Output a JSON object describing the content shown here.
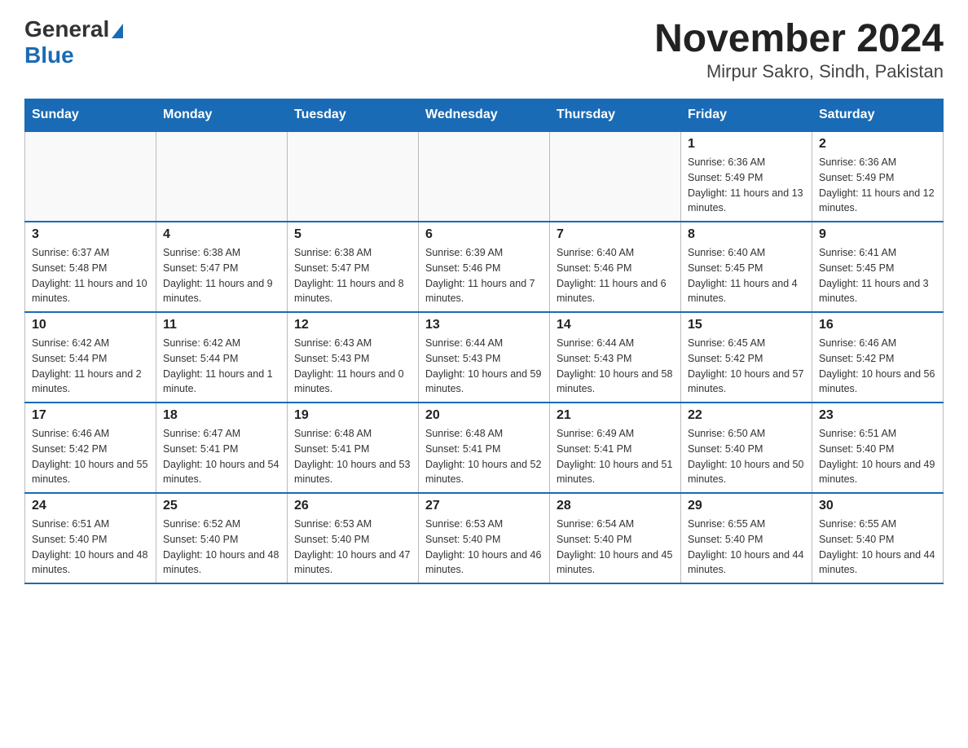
{
  "header": {
    "logo_general": "General",
    "logo_blue": "Blue",
    "title": "November 2024",
    "subtitle": "Mirpur Sakro, Sindh, Pakistan"
  },
  "days_of_week": [
    "Sunday",
    "Monday",
    "Tuesday",
    "Wednesday",
    "Thursday",
    "Friday",
    "Saturday"
  ],
  "weeks": [
    [
      {
        "day": "",
        "info": ""
      },
      {
        "day": "",
        "info": ""
      },
      {
        "day": "",
        "info": ""
      },
      {
        "day": "",
        "info": ""
      },
      {
        "day": "",
        "info": ""
      },
      {
        "day": "1",
        "info": "Sunrise: 6:36 AM\nSunset: 5:49 PM\nDaylight: 11 hours and 13 minutes."
      },
      {
        "day": "2",
        "info": "Sunrise: 6:36 AM\nSunset: 5:49 PM\nDaylight: 11 hours and 12 minutes."
      }
    ],
    [
      {
        "day": "3",
        "info": "Sunrise: 6:37 AM\nSunset: 5:48 PM\nDaylight: 11 hours and 10 minutes."
      },
      {
        "day": "4",
        "info": "Sunrise: 6:38 AM\nSunset: 5:47 PM\nDaylight: 11 hours and 9 minutes."
      },
      {
        "day": "5",
        "info": "Sunrise: 6:38 AM\nSunset: 5:47 PM\nDaylight: 11 hours and 8 minutes."
      },
      {
        "day": "6",
        "info": "Sunrise: 6:39 AM\nSunset: 5:46 PM\nDaylight: 11 hours and 7 minutes."
      },
      {
        "day": "7",
        "info": "Sunrise: 6:40 AM\nSunset: 5:46 PM\nDaylight: 11 hours and 6 minutes."
      },
      {
        "day": "8",
        "info": "Sunrise: 6:40 AM\nSunset: 5:45 PM\nDaylight: 11 hours and 4 minutes."
      },
      {
        "day": "9",
        "info": "Sunrise: 6:41 AM\nSunset: 5:45 PM\nDaylight: 11 hours and 3 minutes."
      }
    ],
    [
      {
        "day": "10",
        "info": "Sunrise: 6:42 AM\nSunset: 5:44 PM\nDaylight: 11 hours and 2 minutes."
      },
      {
        "day": "11",
        "info": "Sunrise: 6:42 AM\nSunset: 5:44 PM\nDaylight: 11 hours and 1 minute."
      },
      {
        "day": "12",
        "info": "Sunrise: 6:43 AM\nSunset: 5:43 PM\nDaylight: 11 hours and 0 minutes."
      },
      {
        "day": "13",
        "info": "Sunrise: 6:44 AM\nSunset: 5:43 PM\nDaylight: 10 hours and 59 minutes."
      },
      {
        "day": "14",
        "info": "Sunrise: 6:44 AM\nSunset: 5:43 PM\nDaylight: 10 hours and 58 minutes."
      },
      {
        "day": "15",
        "info": "Sunrise: 6:45 AM\nSunset: 5:42 PM\nDaylight: 10 hours and 57 minutes."
      },
      {
        "day": "16",
        "info": "Sunrise: 6:46 AM\nSunset: 5:42 PM\nDaylight: 10 hours and 56 minutes."
      }
    ],
    [
      {
        "day": "17",
        "info": "Sunrise: 6:46 AM\nSunset: 5:42 PM\nDaylight: 10 hours and 55 minutes."
      },
      {
        "day": "18",
        "info": "Sunrise: 6:47 AM\nSunset: 5:41 PM\nDaylight: 10 hours and 54 minutes."
      },
      {
        "day": "19",
        "info": "Sunrise: 6:48 AM\nSunset: 5:41 PM\nDaylight: 10 hours and 53 minutes."
      },
      {
        "day": "20",
        "info": "Sunrise: 6:48 AM\nSunset: 5:41 PM\nDaylight: 10 hours and 52 minutes."
      },
      {
        "day": "21",
        "info": "Sunrise: 6:49 AM\nSunset: 5:41 PM\nDaylight: 10 hours and 51 minutes."
      },
      {
        "day": "22",
        "info": "Sunrise: 6:50 AM\nSunset: 5:40 PM\nDaylight: 10 hours and 50 minutes."
      },
      {
        "day": "23",
        "info": "Sunrise: 6:51 AM\nSunset: 5:40 PM\nDaylight: 10 hours and 49 minutes."
      }
    ],
    [
      {
        "day": "24",
        "info": "Sunrise: 6:51 AM\nSunset: 5:40 PM\nDaylight: 10 hours and 48 minutes."
      },
      {
        "day": "25",
        "info": "Sunrise: 6:52 AM\nSunset: 5:40 PM\nDaylight: 10 hours and 48 minutes."
      },
      {
        "day": "26",
        "info": "Sunrise: 6:53 AM\nSunset: 5:40 PM\nDaylight: 10 hours and 47 minutes."
      },
      {
        "day": "27",
        "info": "Sunrise: 6:53 AM\nSunset: 5:40 PM\nDaylight: 10 hours and 46 minutes."
      },
      {
        "day": "28",
        "info": "Sunrise: 6:54 AM\nSunset: 5:40 PM\nDaylight: 10 hours and 45 minutes."
      },
      {
        "day": "29",
        "info": "Sunrise: 6:55 AM\nSunset: 5:40 PM\nDaylight: 10 hours and 44 minutes."
      },
      {
        "day": "30",
        "info": "Sunrise: 6:55 AM\nSunset: 5:40 PM\nDaylight: 10 hours and 44 minutes."
      }
    ]
  ]
}
